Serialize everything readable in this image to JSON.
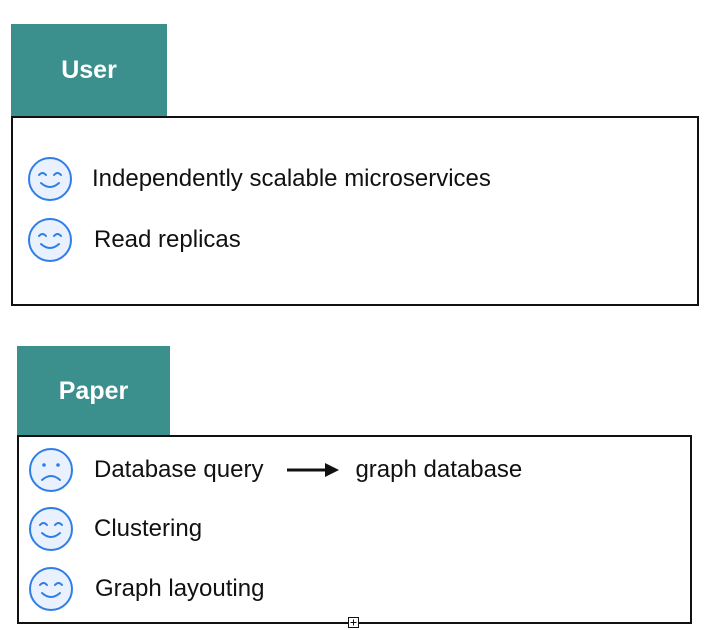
{
  "colors": {
    "tab_fill": "#3b8f8c",
    "tab_text": "#ffffff",
    "face_stroke": "#2f7ee6",
    "face_fill": "#e8f1fd",
    "border": "#111111"
  },
  "user": {
    "title": "User",
    "items": [
      {
        "icon": "smiley-face-icon",
        "text": "Independently scalable microservices"
      },
      {
        "icon": "smiley-face-icon",
        "text": "Read replicas"
      }
    ]
  },
  "paper": {
    "title": "Paper",
    "items": [
      {
        "icon": "sad-face-icon",
        "text": "Database query",
        "arrow_icon": "right-arrow-icon",
        "target": "graph database"
      },
      {
        "icon": "smiley-face-icon",
        "text": "Clustering"
      },
      {
        "icon": "smiley-face-icon",
        "text": "Graph layouting"
      }
    ]
  }
}
